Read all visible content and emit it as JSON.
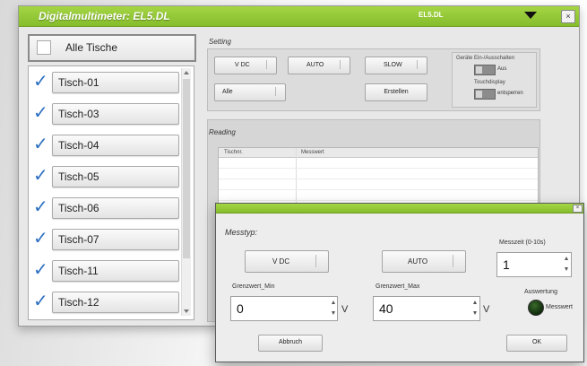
{
  "window": {
    "title": "Digitalmultimeter: EL5.DL",
    "device_select": "EL5.DL",
    "close_label": "×"
  },
  "tables": {
    "all_label": "Alle Tische",
    "items": [
      {
        "label": "Tisch-01",
        "checked": true
      },
      {
        "label": "Tisch-03",
        "checked": true
      },
      {
        "label": "Tisch-04",
        "checked": true
      },
      {
        "label": "Tisch-05",
        "checked": true
      },
      {
        "label": "Tisch-06",
        "checked": true
      },
      {
        "label": "Tisch-07",
        "checked": true
      },
      {
        "label": "Tisch-11",
        "checked": true
      },
      {
        "label": "Tisch-12",
        "checked": true
      }
    ]
  },
  "setting": {
    "section_label": "Setting",
    "mode": "V DC",
    "range": "AUTO",
    "speed": "SLOW",
    "channel": "Alle",
    "create_button": "Erstellen",
    "device_box": {
      "title": "Geräte Ein-/Ausschalten",
      "power_label": "Aus",
      "display_title": "Touchdisplay",
      "display_label": "entsperren"
    }
  },
  "reading": {
    "section_label": "Reading",
    "columns": [
      "Tischnr.",
      "Messwert"
    ],
    "check_mark": "✓"
  },
  "dialog": {
    "close_label": "×",
    "measure_type_label": "Messtyp:",
    "mode": "V DC",
    "range": "AUTO",
    "interval_label": "Messzeit (0-10s)",
    "interval_value": "1",
    "min_label": "Grenzwert_Min",
    "min_value": "0",
    "min_unit": "V",
    "max_label": "Grenzwert_Max",
    "max_value": "40",
    "max_unit": "V",
    "evaluation_label": "Auswertung",
    "led_label": "Messwert",
    "cancel_button": "Abbruch",
    "ok_button": "OK"
  }
}
